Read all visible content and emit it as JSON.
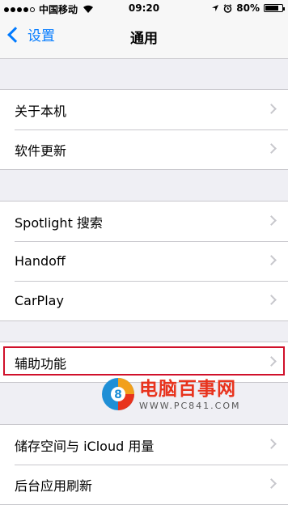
{
  "status_bar": {
    "carrier": "中国移动",
    "time": "09:20",
    "battery": "80%",
    "battery_level": 0.8,
    "signal_bars": 4
  },
  "nav": {
    "back_label": "设置",
    "title": "通用"
  },
  "groups": [
    {
      "items": [
        {
          "label": "关于本机"
        },
        {
          "label": "软件更新"
        }
      ]
    },
    {
      "items": [
        {
          "label": "Spotlight 搜索"
        },
        {
          "label": "Handoff"
        },
        {
          "label": "CarPlay"
        }
      ]
    },
    {
      "items": [
        {
          "label": "辅助功能"
        }
      ]
    },
    {
      "items": [
        {
          "label": "储存空间与 iCloud 用量"
        },
        {
          "label": "后台应用刷新"
        }
      ]
    }
  ],
  "highlight": {
    "target": "辅助功能",
    "color": "#d0102a"
  },
  "watermark": {
    "title": "电脑百事网",
    "url": "WWW.PC841.COM"
  },
  "colors": {
    "accent": "#007aff",
    "background": "#efeff4",
    "separator": "#c8c7cc"
  }
}
